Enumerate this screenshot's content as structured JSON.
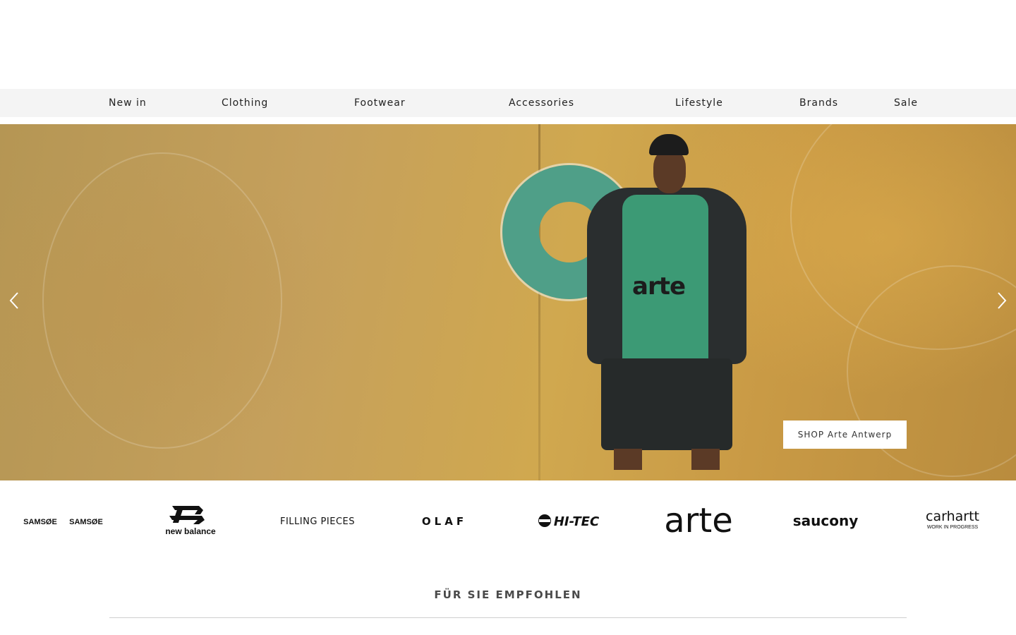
{
  "nav": {
    "items": [
      {
        "label": "New in"
      },
      {
        "label": "Clothing"
      },
      {
        "label": "Footwear"
      },
      {
        "label": "Accessories"
      },
      {
        "label": "Lifestyle"
      },
      {
        "label": "Brands"
      },
      {
        "label": "Sale"
      }
    ]
  },
  "hero": {
    "shirt_text": "arte",
    "cta_label": "SHOP Arte Antwerp",
    "prev_icon": "chevron-left-icon",
    "next_icon": "chevron-right-icon"
  },
  "brands": {
    "samsoe": "SAMSØE",
    "samsoe_2": "SAMSØE",
    "new_balance": "new balance",
    "filling_pieces": "FILLING PIECES",
    "olaf": "OLAF",
    "hitec": "HI-TEC",
    "arte": "arte",
    "saucony": "saucony",
    "carhartt": "carhartt",
    "carhartt_sub": "WORK IN PROGRESS"
  },
  "section": {
    "title": "FÜR SIE EMPFOHLEN"
  },
  "colors": {
    "nav_bg": "#f4f4f4",
    "hero_wall": "#c9a050",
    "graffiti": "#4f9f88"
  }
}
